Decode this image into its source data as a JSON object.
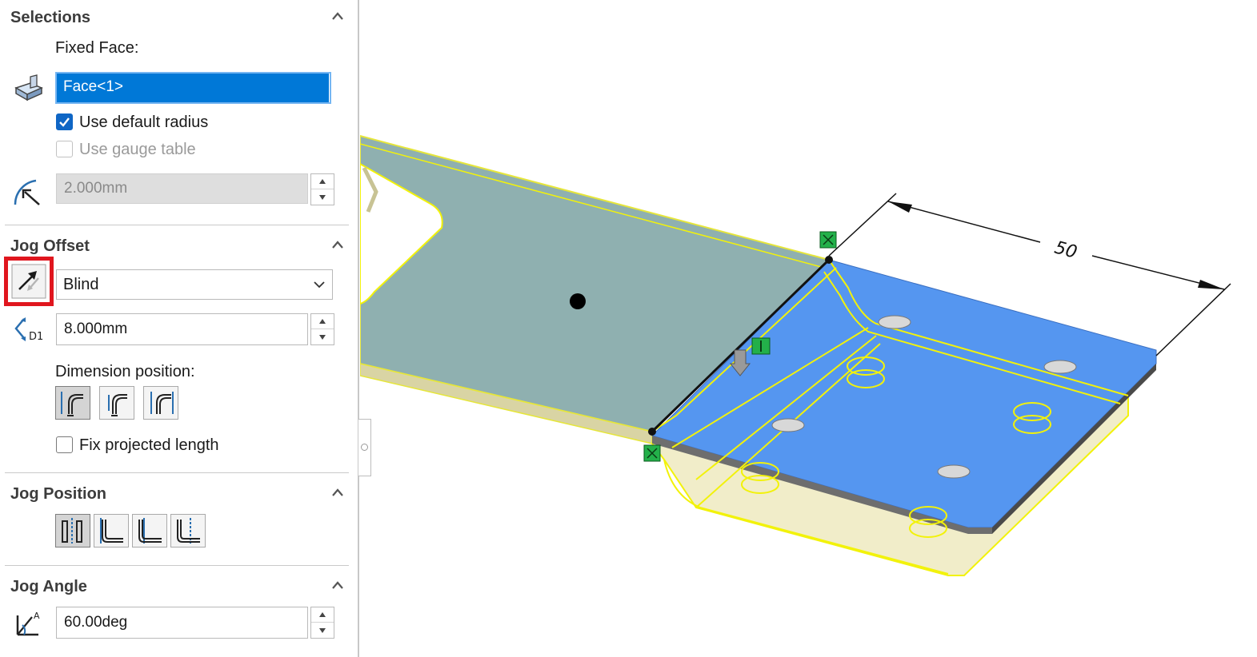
{
  "selections": {
    "title": "Selections",
    "fixed_face_label": "Fixed Face:",
    "fixed_face_value": "Face<1>",
    "use_default_radius": {
      "label": "Use default radius",
      "checked": true
    },
    "use_gauge_table": {
      "label": "Use gauge table",
      "checked": false,
      "enabled": false
    },
    "radius_value": "2.000mm"
  },
  "jog_offset": {
    "title": "Jog Offset",
    "end_condition": "Blind",
    "offset_distance": "8.000mm",
    "dimension_position_label": "Dimension position:",
    "fix_projected_length": {
      "label": "Fix projected length",
      "checked": false
    }
  },
  "jog_position": {
    "title": "Jog Position"
  },
  "jog_angle": {
    "title": "Jog Angle",
    "angle_value": "60.00deg"
  },
  "viewport": {
    "dimension_text": "50"
  },
  "colors": {
    "selection_blue": "#0078d7",
    "highlight_red": "#e0161e",
    "preview_yellow": "#f2f20a",
    "face_blue": "#5596f0"
  }
}
